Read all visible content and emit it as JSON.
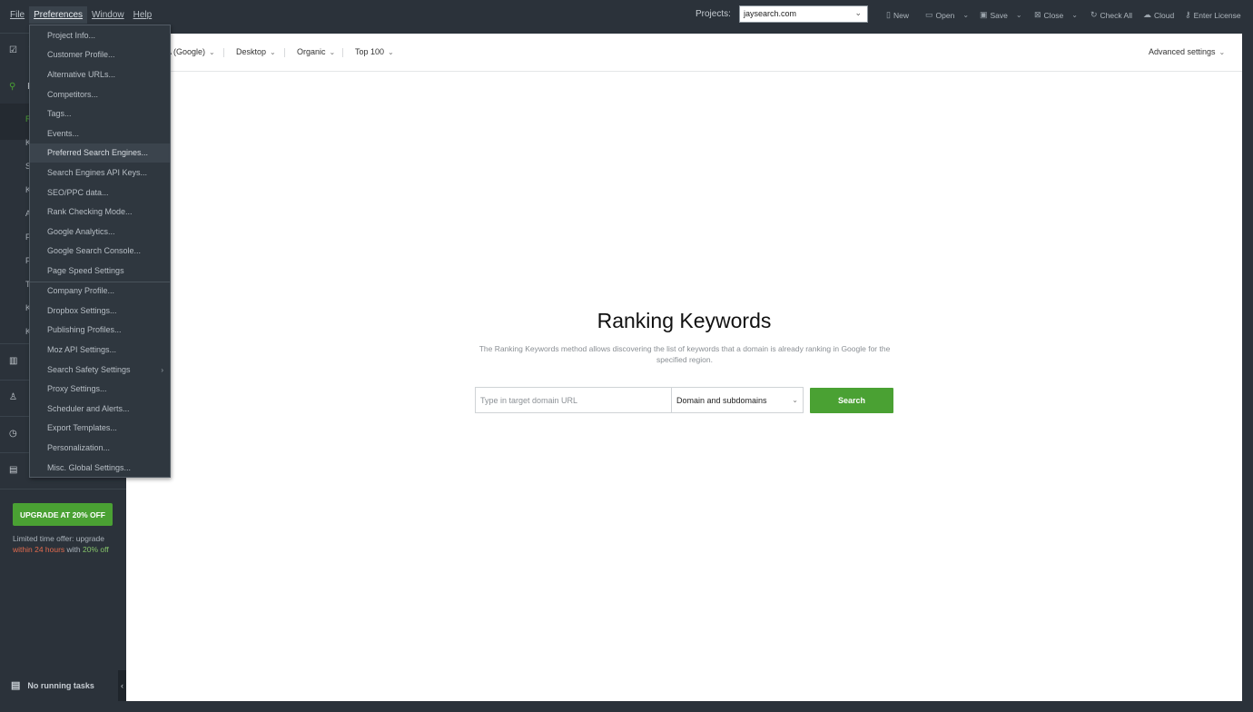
{
  "menubar": {
    "file": "File",
    "preferences": "Preferences",
    "window": "Window",
    "help": "Help"
  },
  "toolbar": {
    "projects_label": "Projects:",
    "project_value": "jaysearch.com",
    "new": "New",
    "open": "Open",
    "save": "Save",
    "close": "Close",
    "check_all": "Check All",
    "cloud": "Cloud",
    "enter_license": "Enter License"
  },
  "sidebar": {
    "section1_letter": "T",
    "section2_letter": "K",
    "sub_letters": [
      "R",
      "K",
      "S",
      "K",
      "A",
      "F",
      "F",
      "T",
      "K",
      "K"
    ],
    "section3_letter": "S",
    "section4_letter": "C",
    "section5_letter": "D",
    "section6_letter": "F",
    "upgrade_button": "UPGRADE AT 20% OFF",
    "offer_line1": "Limited time offer: upgrade",
    "offer_red": "within 24 hours",
    "offer_with": " with ",
    "offer_green": "20% off",
    "tasks": "No running tasks",
    "collapse_glyph": "‹"
  },
  "filters": {
    "engine": "A (Google)",
    "device": "Desktop",
    "type": "Organic",
    "depth": "Top 100",
    "advanced": "Advanced settings"
  },
  "main": {
    "title": "Ranking Keywords",
    "description": "The Ranking Keywords method allows discovering the list of keywords that a domain is already ranking in Google for the specified region.",
    "url_placeholder": "Type in target domain URL",
    "scope_value": "Domain and subdomains",
    "search_button": "Search"
  },
  "preferences_menu": {
    "items": [
      "Project Info...",
      "Customer Profile...",
      "Alternative URLs...",
      "Competitors...",
      "Tags...",
      "Events...",
      "Preferred Search Engines...",
      "Search Engines API Keys...",
      "SEO/PPC data...",
      "Rank Checking Mode...",
      "Google Analytics...",
      "Google Search Console...",
      "Page Speed Settings",
      "Company Profile...",
      "Dropbox Settings...",
      "Publishing Profiles...",
      "Moz API Settings...",
      "Search Safety Settings",
      "Proxy Settings...",
      "Scheduler and Alerts...",
      "Export Templates...",
      "Personalization...",
      "Misc. Global Settings..."
    ],
    "highlighted": "Preferred Search Engines..."
  },
  "colors": {
    "accent_green": "#4aa133",
    "dark_bg": "#2b323a",
    "offer_red": "#e36b4e"
  }
}
